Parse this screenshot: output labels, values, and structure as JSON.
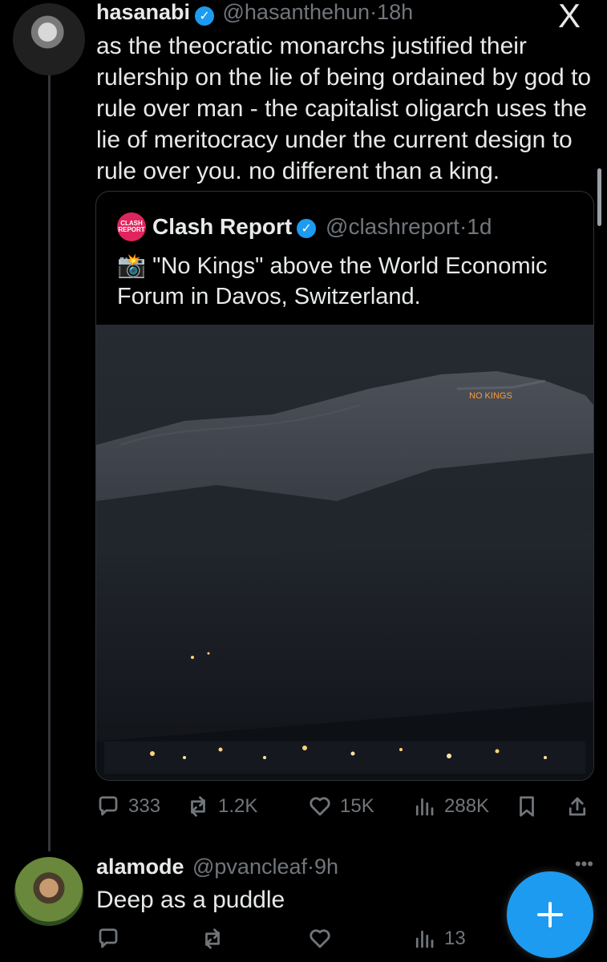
{
  "tweet": {
    "author_name": "hasanabi",
    "author_handle": "@hasanthehun",
    "dot": "·",
    "time": "18h",
    "text": "as the theocratic monarchs justified their rulership on the lie of being ordained by god to rule over man - the capitalist oligarch uses the lie of meritocracy under the current design to rule over you. no different than a king.",
    "quote": {
      "logo_text": "CLASH REPORT",
      "author_name": "Clash Report",
      "author_handle": "@clashreport",
      "time": "1d",
      "emoji": "📸",
      "text": "\"No Kings\" above the World Economic Forum in Davos, Switzerland.",
      "image_overlay_text": "NO KINGS"
    },
    "metrics": {
      "replies": "333",
      "retweets": "1.2K",
      "likes": "15K",
      "views": "288K"
    }
  },
  "reply": {
    "author_name": "alamode",
    "author_handle": "@pvancleaf",
    "time": "9h",
    "text": "Deep as a puddle",
    "metrics": {
      "views": "13"
    }
  },
  "icons": {
    "x_logo": "X",
    "verified": "✓",
    "more": "•••"
  },
  "colors": {
    "accent": "#1d9bf0",
    "text": "#e7e9ea",
    "muted": "#71767b",
    "border": "#2f3336",
    "background": "#000000"
  }
}
